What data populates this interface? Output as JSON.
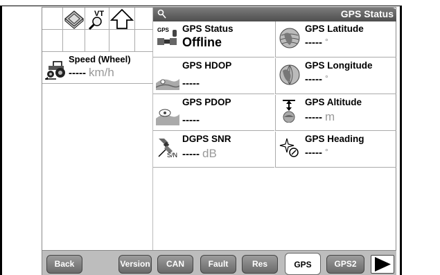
{
  "header": {
    "title": "GPS Status",
    "vt_label": "VT"
  },
  "left": {
    "speed_label": "Speed (Wheel)",
    "speed_value": "-----",
    "speed_unit": "km/h"
  },
  "tiles": [
    {
      "label": "GPS Status",
      "value": "Offline",
      "unit": "",
      "icon": "satellite-icon",
      "tag": "GPS"
    },
    {
      "label": "GPS Latitude",
      "value": "-----",
      "unit": "°",
      "icon": "globe-latitude-icon"
    },
    {
      "label": "GPS HDOP",
      "value": "-----",
      "unit": "",
      "icon": "map-hdop-icon"
    },
    {
      "label": "GPS Longitude",
      "value": "-----",
      "unit": "°",
      "icon": "globe-longitude-icon"
    },
    {
      "label": "GPS PDOP",
      "value": "-----",
      "unit": "",
      "icon": "map-pdop-icon"
    },
    {
      "label": "GPS Altitude",
      "value": "-----",
      "unit": "m",
      "icon": "altitude-icon"
    },
    {
      "label": "DGPS SNR",
      "value": "-----",
      "unit": "dB",
      "icon": "snr-satellite-icon"
    },
    {
      "label": "GPS Heading",
      "value": "-----",
      "unit": "°",
      "icon": "compass-icon"
    }
  ],
  "nav": {
    "back": "Back",
    "version": "Version",
    "can": "CAN",
    "fault": "Fault",
    "res": "Res",
    "gps": "GPS",
    "gps2": "GPS2"
  }
}
